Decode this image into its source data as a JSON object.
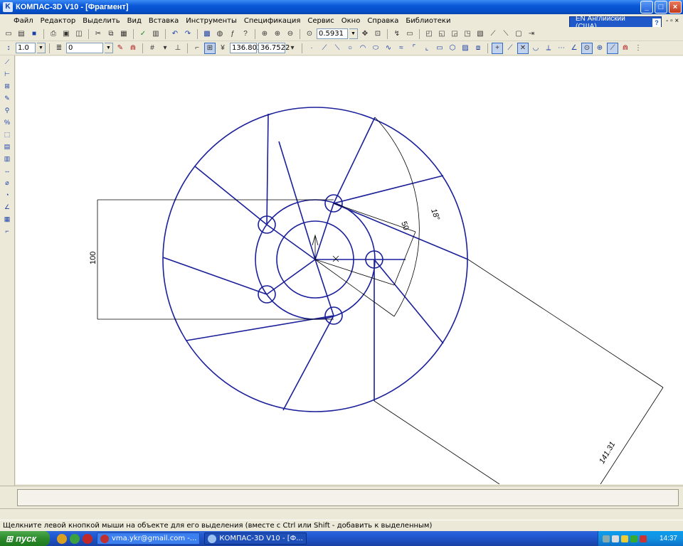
{
  "window": {
    "title": "КОМПАС-3D V10 - [Фрагмент]",
    "controls": {
      "minimize": "_",
      "maximize": "□",
      "close": "×"
    }
  },
  "menu": {
    "items": [
      "Файл",
      "Редактор",
      "Выделить",
      "Вид",
      "Вставка",
      "Инструменты",
      "Спецификация",
      "Сервис",
      "Окно",
      "Справка",
      "Библиотеки"
    ]
  },
  "language_bar": {
    "label": "EN Английский (США)",
    "help": "?"
  },
  "doc_controls": "- ▫ ×",
  "toolbar1": {
    "zoom_value": "0.5931"
  },
  "toolbar2": {
    "step_value": "1.0",
    "layer_value": "0",
    "x_coord": "136.803",
    "y_coord": "36.7522"
  },
  "drawing": {
    "dimensions": {
      "vertical": "100",
      "radial": "50",
      "angle": "18°",
      "long": "141.31"
    }
  },
  "status": {
    "hint": "Щелкните левой кнопкой мыши на объекте для его выделения (вместе с Ctrl или Shift - добавить к выделенным)"
  },
  "taskbar": {
    "start": "пуск",
    "tasks": [
      "vma.ykr@gmail.com -...",
      "КОМПАС-3D V10 - [Ф..."
    ],
    "clock": "14:37"
  },
  "colors": {
    "line": "#1a1f9a",
    "dim": "#000000",
    "canvas": "#ffffff",
    "xp_blue": "#0a58d8"
  }
}
